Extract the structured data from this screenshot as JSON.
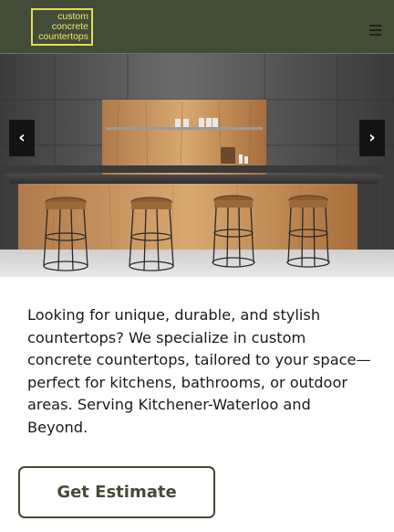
{
  "header": {
    "logo_lines": [
      "custom",
      "concrete",
      "countertops"
    ],
    "menu_icon": "hamburger-menu-icon"
  },
  "hero": {
    "image_alt": "Concrete kitchen island with wooden front, four bar stools, and open wooden shelving against a dark concrete wall",
    "prev_label": "‹",
    "next_label": "›",
    "prev_icon": "chevron-left-icon",
    "next_icon": "chevron-right-icon"
  },
  "intro": {
    "text": "Looking for unique, durable, and stylish countertops? We specialize in custom concrete countertops, tailored to your space—perfect for kitchens, bathrooms, or outdoor areas. Serving Kitchener-Waterloo and Beyond."
  },
  "cta": {
    "label": "Get Estimate"
  },
  "colors": {
    "header_bg": "#434c36",
    "logo_accent": "#e3da5f",
    "button_border": "#434c36"
  }
}
